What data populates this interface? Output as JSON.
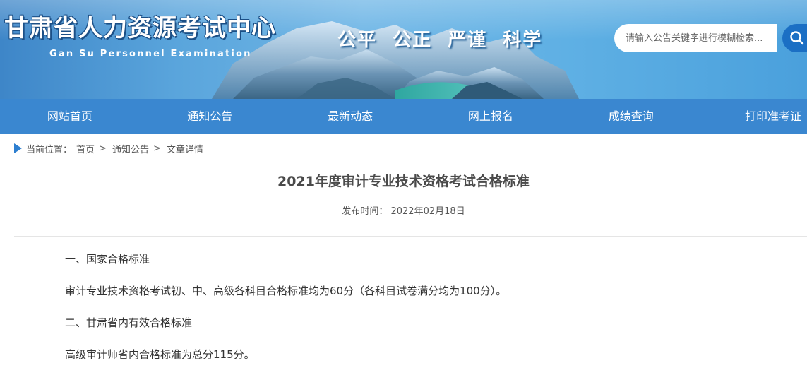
{
  "header": {
    "logo_cn": "甘肃省人力资源考试中心",
    "logo_en": "Gan Su Personnel Examination",
    "slogan": "公平  公正  严谨  科学",
    "search_placeholder": "请输入公告关键字进行模糊检索..."
  },
  "nav": {
    "items": [
      "网站首页",
      "通知公告",
      "最新动态",
      "网上报名",
      "成绩查询",
      "打印准考证"
    ]
  },
  "breadcrumb": {
    "prefix": "当前位置：",
    "items": [
      "首页",
      "通知公告",
      "文章详情"
    ],
    "separator": ">"
  },
  "article": {
    "title": "2021年度审计专业技术资格考试合格标准",
    "date_label": "发布时间：",
    "date_value": "2022年02月18日",
    "paragraphs": [
      "一、国家合格标准",
      "审计专业技术资格考试初、中、高级各科目合格标准均为60分（各科目试卷满分均为100分）。",
      "二、甘肃省内有效合格标准",
      "高级审计师省内合格标准为总分115分。"
    ]
  },
  "colors": {
    "nav_bg": "#3a87d0",
    "accent": "#2d7fd0",
    "search_button": "#1b6fc4"
  }
}
